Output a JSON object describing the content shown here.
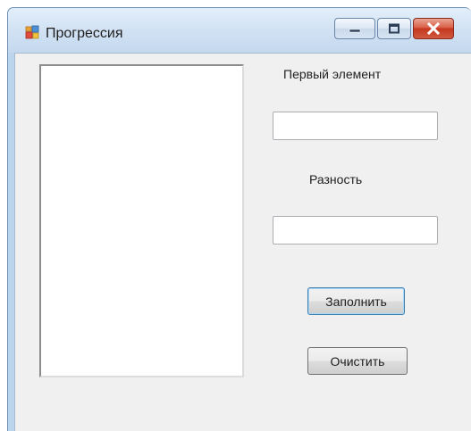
{
  "window": {
    "title": "Прогрессия",
    "icons": {
      "app": "app-form-icon",
      "minimize": "minimize-icon",
      "maximize": "maximize-icon",
      "close": "close-icon"
    },
    "colors": {
      "chrome": "#bcd5ee",
      "client": "#f0f0f0",
      "close_button": "#c4371f"
    }
  },
  "form": {
    "first_element_label": "Первый элемент",
    "first_element_value": "",
    "difference_label": "Разность",
    "difference_value": "",
    "fill_button": "Заполнить",
    "clear_button": "Очистить"
  },
  "listbox": {
    "items": []
  }
}
